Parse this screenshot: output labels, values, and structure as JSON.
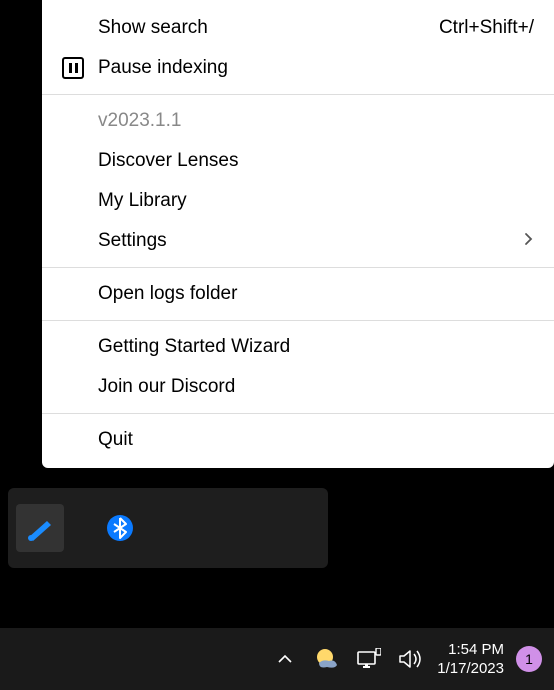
{
  "menu": {
    "items": [
      {
        "label": "Show search",
        "shortcut": "Ctrl+Shift+/"
      },
      {
        "label": "Pause indexing"
      }
    ],
    "version": "v2023.1.1",
    "group2": [
      {
        "label": "Discover Lenses"
      },
      {
        "label": "My Library"
      },
      {
        "label": "Settings",
        "has_submenu": true
      }
    ],
    "group3": [
      {
        "label": "Open logs folder"
      }
    ],
    "group4": [
      {
        "label": "Getting Started Wizard"
      },
      {
        "label": "Join our Discord"
      }
    ],
    "group5": [
      {
        "label": "Quit"
      }
    ]
  },
  "taskbar": {
    "time": "1:54 PM",
    "date": "1/17/2023",
    "notification_count": "1"
  }
}
